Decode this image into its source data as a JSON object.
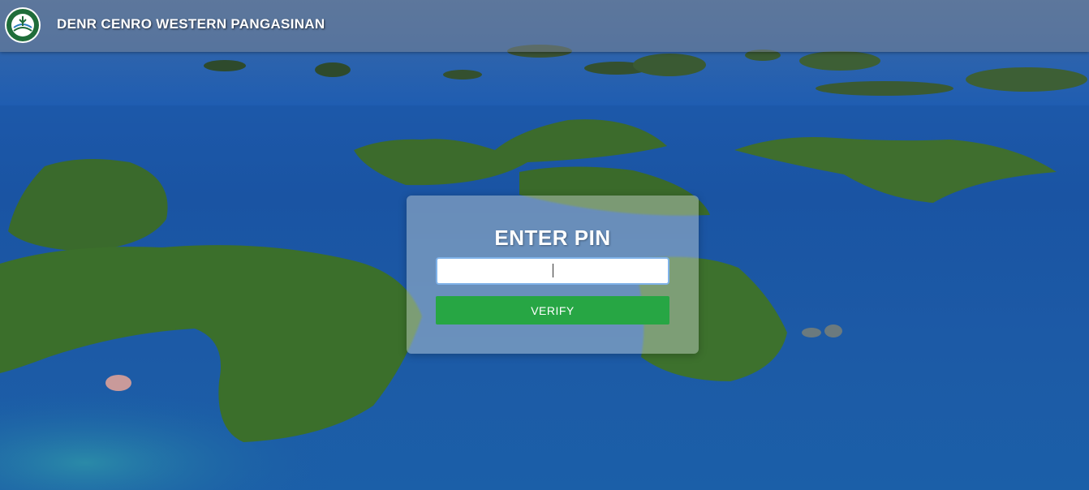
{
  "header": {
    "title": "DENR CENRO WESTERN PANGASINAN",
    "logo_icon": "denr-seal-logo"
  },
  "pin_form": {
    "title": "ENTER PIN",
    "pin_value": "",
    "verify_label": "VERIFY"
  },
  "colors": {
    "verify_button": "#27a644",
    "input_focus_border": "#7fb2e8",
    "header_bar": "#788291"
  }
}
